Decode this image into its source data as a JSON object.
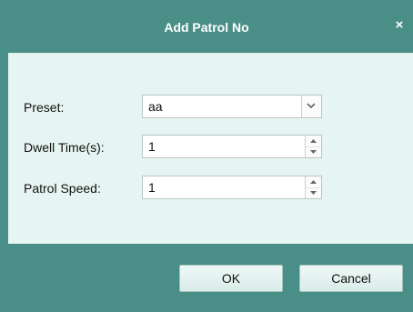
{
  "dialog": {
    "title": "Add Patrol No",
    "close_glyph": "×"
  },
  "form": {
    "preset": {
      "label": "Preset:",
      "value": "aa"
    },
    "dwell_time": {
      "label": "Dwell Time(s):",
      "value": "1"
    },
    "patrol_speed": {
      "label": "Patrol Speed:",
      "value": "1"
    }
  },
  "buttons": {
    "ok": "OK",
    "cancel": "Cancel"
  },
  "colors": {
    "header": "#4a8f87",
    "content": "#e7f5f2"
  }
}
